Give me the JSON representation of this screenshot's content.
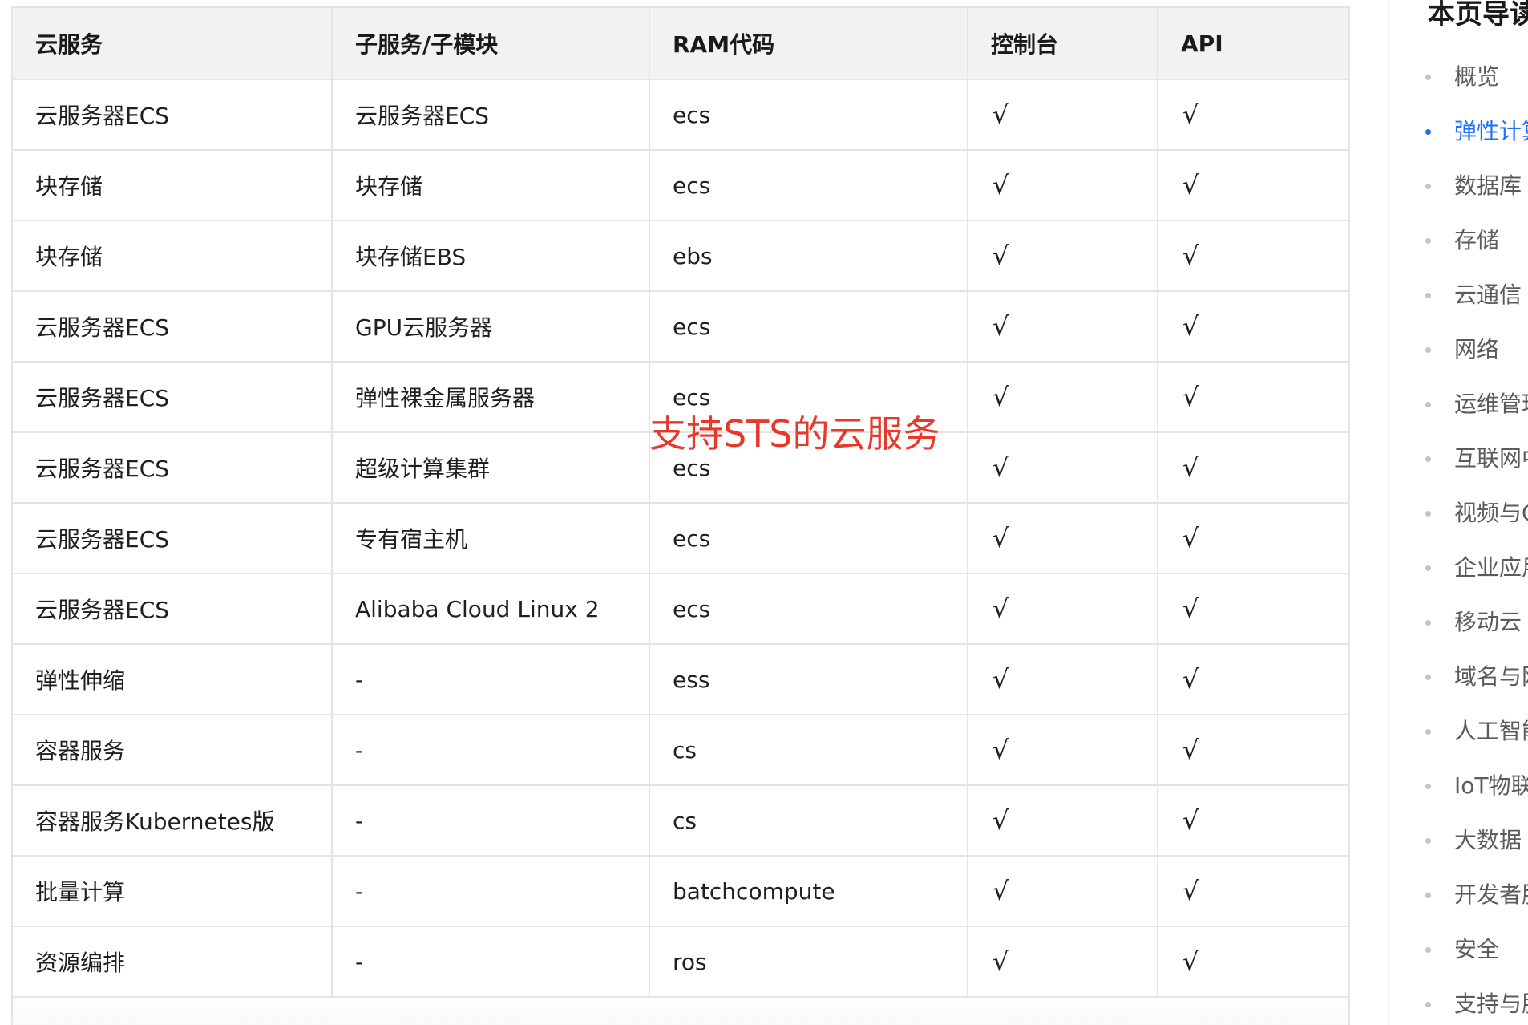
{
  "table": {
    "headers": [
      "云服务",
      "子服务/子模块",
      "RAM代码",
      "控制台",
      "API"
    ],
    "rows": [
      [
        "云服务器ECS",
        "云服务器ECS",
        "ecs",
        "√",
        "√"
      ],
      [
        "块存储",
        "块存储",
        "ecs",
        "√",
        "√"
      ],
      [
        "块存储",
        "块存储EBS",
        "ebs",
        "√",
        "√"
      ],
      [
        "云服务器ECS",
        "GPU云服务器",
        "ecs",
        "√",
        "√"
      ],
      [
        "云服务器ECS",
        "弹性裸金属服务器",
        "ecs",
        "√",
        "√"
      ],
      [
        "云服务器ECS",
        "超级计算集群",
        "ecs",
        "√",
        "√"
      ],
      [
        "云服务器ECS",
        "专有宿主机",
        "ecs",
        "√",
        "√"
      ],
      [
        "云服务器ECS",
        "Alibaba Cloud Linux 2",
        "ecs",
        "√",
        "√"
      ],
      [
        "弹性伸缩",
        "-",
        "ess",
        "√",
        "√"
      ],
      [
        "容器服务",
        "-",
        "cs",
        "√",
        "√"
      ],
      [
        "容器服务Kubernetes版",
        "-",
        "cs",
        "√",
        "√"
      ],
      [
        "批量计算",
        "-",
        "batchcompute",
        "√",
        "√"
      ],
      [
        "资源编排",
        "-",
        "ros",
        "√",
        "√"
      ]
    ]
  },
  "overlay": {
    "text": "支持STS的云服务",
    "color": "#e8382a"
  },
  "toc": {
    "title": "本页导读",
    "active_color": "#1f6fff",
    "items": [
      {
        "label": "概览",
        "active": false
      },
      {
        "label": "弹性计算",
        "active": true
      },
      {
        "label": "数据库",
        "active": false
      },
      {
        "label": "存储",
        "active": false
      },
      {
        "label": "云通信",
        "active": false
      },
      {
        "label": "网络",
        "active": false
      },
      {
        "label": "运维管理",
        "active": false
      },
      {
        "label": "互联网中间件",
        "active": false
      },
      {
        "label": "视频与CDN",
        "active": false
      },
      {
        "label": "企业应用",
        "active": false
      },
      {
        "label": "移动云",
        "active": false
      },
      {
        "label": "域名与网站",
        "active": false
      },
      {
        "label": "人工智能",
        "active": false
      },
      {
        "label": "IoT物联网",
        "active": false
      },
      {
        "label": "大数据",
        "active": false
      },
      {
        "label": "开发者服务",
        "active": false
      },
      {
        "label": "安全",
        "active": false
      },
      {
        "label": "支持与服务",
        "active": false
      }
    ]
  }
}
